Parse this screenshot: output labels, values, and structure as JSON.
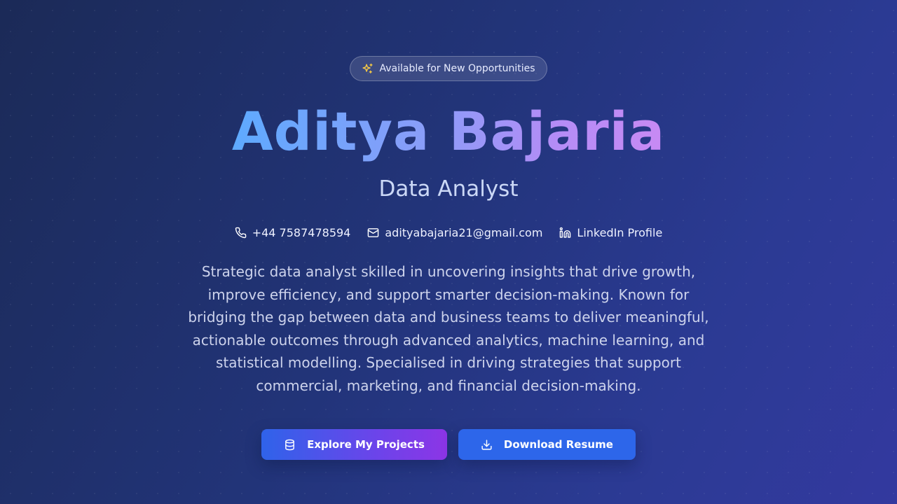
{
  "badge": {
    "icon": "sparkles-icon",
    "label": "Available for New Opportunities"
  },
  "hero": {
    "name": "Aditya Bajaria",
    "role": "Data Analyst",
    "bio": "Strategic data analyst skilled in uncovering insights that drive growth, improve efficiency, and support smarter decision-making. Known for bridging the gap between data and business teams to deliver meaningful, actionable outcomes through advanced analytics, machine learning, and statistical modelling. Specialised in driving strategies that support commercial, marketing, and financial decision-making."
  },
  "contacts": {
    "phone": "+44 7587478594",
    "email": "adityabajaria21@gmail.com",
    "linkedin": "LinkedIn Profile"
  },
  "actions": {
    "projects_label": "Explore My Projects",
    "resume_label": "Download Resume"
  },
  "colors": {
    "name_gradient_start": "#5eaaff",
    "name_gradient_end": "#c88af4",
    "badge_icon": "#f6c944",
    "primary_button_start": "#2f63ea",
    "primary_button_end": "#8c35e6",
    "secondary_button": "#2d66ea"
  }
}
